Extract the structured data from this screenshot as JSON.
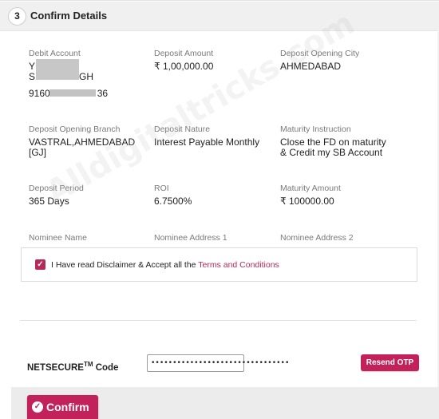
{
  "header": {
    "step_number": "3",
    "title": "Confirm Details"
  },
  "details": {
    "debit_account": {
      "label": "Debit Account",
      "name_line1": "Y",
      "name_line2": "S",
      "name_line2_tail": "GH",
      "number_prefix": "9160",
      "number_suffix": "36"
    },
    "deposit_amount": {
      "label": "Deposit Amount",
      "value": "₹ 1,00,000.00"
    },
    "deposit_opening_city": {
      "label": "Deposit Opening City",
      "value": "AHMEDABAD"
    },
    "deposit_opening_branch": {
      "label": "Deposit Opening Branch",
      "value_line1": "VASTRAL,AHMEDABAD",
      "value_line2": "[GJ]"
    },
    "deposit_nature": {
      "label": "Deposit Nature",
      "value": "Interest Payable Monthly"
    },
    "maturity_instruction": {
      "label": "Maturity Instruction",
      "value_line1": "Close the FD on maturity",
      "value_line2": "& Credit my SB Account"
    },
    "deposit_period": {
      "label": "Deposit Period",
      "value": "365 Days"
    },
    "roi": {
      "label": "ROI",
      "value": "6.7500%"
    },
    "maturity_amount": {
      "label": "Maturity Amount",
      "value": "₹ 100000.00"
    },
    "nominee_name": {
      "label": "Nominee Name"
    },
    "nominee_address_1": {
      "label": "Nominee Address 1"
    },
    "nominee_address_2": {
      "label": "Nominee Address 2"
    }
  },
  "disclaimer": {
    "text": "I Have read Disclaimer & Accept all the ",
    "link": "Terms and Conditions",
    "checked": true
  },
  "netsecure": {
    "label": "NETSECURE",
    "label_sup": "TM",
    "label_suffix": " Code",
    "value": "••••••••••••••••••••••••••••••••",
    "resend_label": "Resend OTP"
  },
  "confirm": {
    "label": "Confirm"
  },
  "watermark": "Alldigitaltricks.com",
  "colors": {
    "accent": "#c2215a",
    "checkbox": "#b8295a"
  }
}
